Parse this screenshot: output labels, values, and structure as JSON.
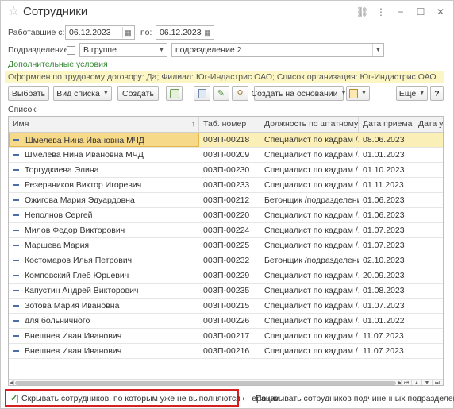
{
  "window": {
    "title": "Сотрудники"
  },
  "filters": {
    "worked_label": "Работавшие с:",
    "date_from": "06.12.2023",
    "to_label": "по:",
    "date_to": "06.12.2023",
    "department_label": "Подразделение:",
    "mode_value": "В группе",
    "department_value": "подразделение 2"
  },
  "conditions": {
    "title": "Дополнительные условия",
    "text": "Оформлен по трудовому договору: Да; Филиал: Юг-Индастрис ОАО; Список организация: Юг-Индастрис ОАО"
  },
  "toolbar": {
    "select": "Выбрать",
    "list_view": "Вид списка",
    "create": "Создать",
    "create_based": "Создать на основании",
    "more": "Еще",
    "help": "?"
  },
  "list_label": "Список:",
  "table": {
    "headers": [
      "Имя",
      "Таб. номер",
      "Должность по штатному ...",
      "Дата приема",
      "Дата увол"
    ],
    "rows": [
      {
        "name": "Шмелева Нина Ивановна МЧД",
        "tab": "00ЗП-00218",
        "pos": "Специалист по кадрам /...",
        "date": "08.06.2023"
      },
      {
        "name": "Шмелева Нина Ивановна МЧД",
        "tab": "00ЗП-00209",
        "pos": "Специалист по кадрам /...",
        "date": "01.01.2023"
      },
      {
        "name": "Торгудкиева Элина",
        "tab": "00ЗП-00230",
        "pos": "Специалист по кадрам /...",
        "date": "01.10.2023"
      },
      {
        "name": "Резервников Виктор Игоревич",
        "tab": "00ЗП-00233",
        "pos": "Специалист по кадрам /...",
        "date": "01.11.2023"
      },
      {
        "name": "Ожигова Мария Эдуардовна",
        "tab": "00ЗП-00212",
        "pos": "Бетонщик /подразделени...",
        "date": "01.06.2023"
      },
      {
        "name": "Неполнов Сергей",
        "tab": "00ЗП-00220",
        "pos": "Специалист по кадрам /...",
        "date": "01.06.2023"
      },
      {
        "name": "Милов Федор Викторович",
        "tab": "00ЗП-00224",
        "pos": "Специалист по кадрам /...",
        "date": "01.07.2023"
      },
      {
        "name": "Маршева Мария",
        "tab": "00ЗП-00225",
        "pos": "Специалист по кадрам /...",
        "date": "01.07.2023"
      },
      {
        "name": "Костомаров Илья Петрович",
        "tab": "00ЗП-00232",
        "pos": "Бетонщик /подразделени...",
        "date": "02.10.2023"
      },
      {
        "name": "Комповский Глеб Юрьевич",
        "tab": "00ЗП-00229",
        "pos": "Специалист по кадрам /...",
        "date": "20.09.2023"
      },
      {
        "name": "Капустин Андрей Викторович",
        "tab": "00ЗП-00235",
        "pos": "Специалист по кадрам /...",
        "date": "01.08.2023"
      },
      {
        "name": "Зотова Мария Ивановна",
        "tab": "00ЗП-00215",
        "pos": "Специалист по кадрам /...",
        "date": "01.07.2023"
      },
      {
        "name": "для больничного",
        "tab": "00ЗП-00226",
        "pos": "Специалист по кадрам /...",
        "date": "01.01.2022"
      },
      {
        "name": "Внешнев Иван Иванович",
        "tab": "00ЗП-00217",
        "pos": "Специалист по кадрам /...",
        "date": "11.07.2023"
      },
      {
        "name": "Внешнев Иван Иванович",
        "tab": "00ЗП-00216",
        "pos": "Специалист по кадрам /...",
        "date": "11.07.2023"
      }
    ]
  },
  "bottom": {
    "hide_inactive": "Скрывать сотрудников, по которым уже не выполняются операции",
    "hide_inactive_checked": true,
    "show_sub": "Показывать сотрудников подчиненных подразделений",
    "show_sub_checked": false
  },
  "colors": {
    "highlight_border": "#d61f1f",
    "selected_row": "#fbefb8",
    "conditions_bg": "#fbf6c4",
    "conditions_title": "#3a8a3a"
  }
}
